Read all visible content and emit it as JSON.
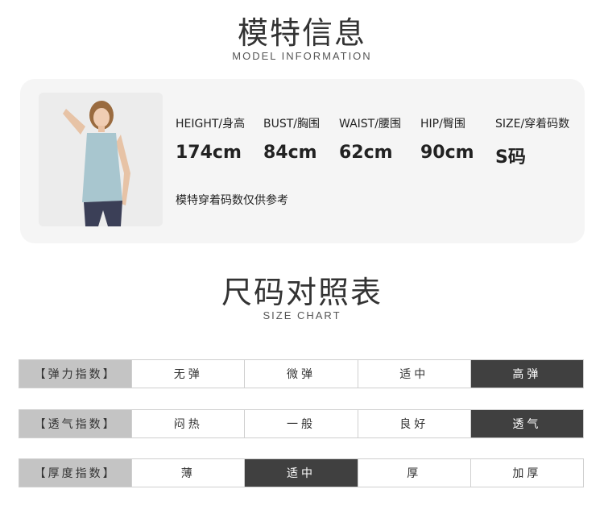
{
  "model_section": {
    "title": "模特信息",
    "subtitle": "MODEL INFORMATION",
    "stats": [
      {
        "label": "HEIGHT/身高",
        "value": "174cm"
      },
      {
        "label": "BUST/胸围",
        "value": "84cm"
      },
      {
        "label": "WAIST/腰围",
        "value": "62cm"
      },
      {
        "label": "HIP/臀围",
        "value": "90cm"
      },
      {
        "label": "SIZE/穿着码数",
        "value": "S码"
      }
    ],
    "note": "模特穿着码数仅供参考"
  },
  "size_section": {
    "title": "尺码对照表",
    "subtitle": "SIZE  CHART"
  },
  "rows": [
    {
      "header": "【弹力指数】",
      "options": [
        "无弹",
        "微弹",
        "适中",
        "高弹"
      ],
      "active_index": 3
    },
    {
      "header": "【透气指数】",
      "options": [
        "闷热",
        "一般",
        "良好",
        "透气"
      ],
      "active_index": 3
    },
    {
      "header": "【厚度指数】",
      "options": [
        "薄",
        "适中",
        "厚",
        "加厚"
      ],
      "active_index": 1
    }
  ],
  "colors": {
    "active_cell": "#404040",
    "header_cell": "#c4c4c4",
    "card_bg": "#f5f5f5"
  }
}
